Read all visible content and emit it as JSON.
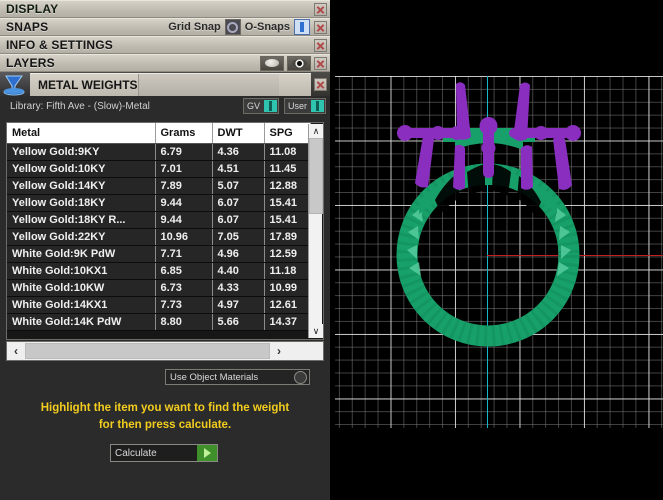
{
  "panels": [
    {
      "id": "display",
      "title": "DISPLAY",
      "close_label": "x"
    },
    {
      "id": "snaps",
      "title": "SNAPS",
      "close_label": "x"
    },
    {
      "id": "info",
      "title": "INFO & SETTINGS",
      "close_label": "x"
    },
    {
      "id": "layers",
      "title": "LAYERS",
      "close_label": "x"
    }
  ],
  "snaps": {
    "grid_snap_label": "Grid Snap",
    "osnaps_label": "O-Snaps",
    "osnap_icon": "circle-snap-icon",
    "toggle_icon": "toggle-on-icon"
  },
  "layers": {
    "ellipse_icon": "ellipse-layer-icon",
    "eye_icon": "eye-visibility-icon"
  },
  "metal_weights": {
    "title": "METAL WEIGHTS",
    "icon": "metal-weights-funnel-icon",
    "close_label": "x"
  },
  "library": {
    "label": "Library: Fifth Ave - (Slow)-Metal",
    "gv_label": "GV",
    "user_label": "User"
  },
  "table": {
    "columns": [
      "Metal",
      "Grams",
      "DWT",
      "SPG"
    ],
    "rows": [
      [
        "Yellow Gold:9KY",
        "6.79",
        "4.36",
        "11.08"
      ],
      [
        "Yellow Gold:10KY",
        "7.01",
        "4.51",
        "11.45"
      ],
      [
        "Yellow Gold:14KY",
        "7.89",
        "5.07",
        "12.88"
      ],
      [
        "Yellow Gold:18KY",
        "9.44",
        "6.07",
        "15.41"
      ],
      [
        "Yellow Gold:18KY R...",
        "9.44",
        "6.07",
        "15.41"
      ],
      [
        "Yellow Gold:22KY",
        "10.96",
        "7.05",
        "17.89"
      ],
      [
        "White Gold:9K PdW",
        "7.71",
        "4.96",
        "12.59"
      ],
      [
        "White Gold:10KX1",
        "6.85",
        "4.40",
        "11.18"
      ],
      [
        "White Gold:10KW",
        "6.73",
        "4.33",
        "10.99"
      ],
      [
        "White Gold:14KX1",
        "7.73",
        "4.97",
        "12.61"
      ],
      [
        "White Gold:14K PdW",
        "8.80",
        "5.66",
        "14.37"
      ]
    ],
    "scroll_up_label": "∧",
    "scroll_down_label": "∨",
    "scroll_left_label": "‹",
    "scroll_right_label": "›"
  },
  "footer": {
    "use_object_materials_label": "Use Object Materials",
    "use_object_materials_icon": "radio-toggle-icon",
    "hint_line1": "Highlight the item you want to find the weight",
    "hint_line2": "for then press calculate.",
    "calculate_label": "Calculate",
    "calculate_icon": "play-arrow-icon"
  },
  "viewport": {
    "name": "3d-ring-viewport",
    "background_color": "#000000",
    "grid_color": "#e6e6e6",
    "y_axis_color": "#14b8c8",
    "x_axis_color": "#c02020",
    "model_band_color": "#18a06a",
    "model_prong_color": "#8a2ec0"
  }
}
